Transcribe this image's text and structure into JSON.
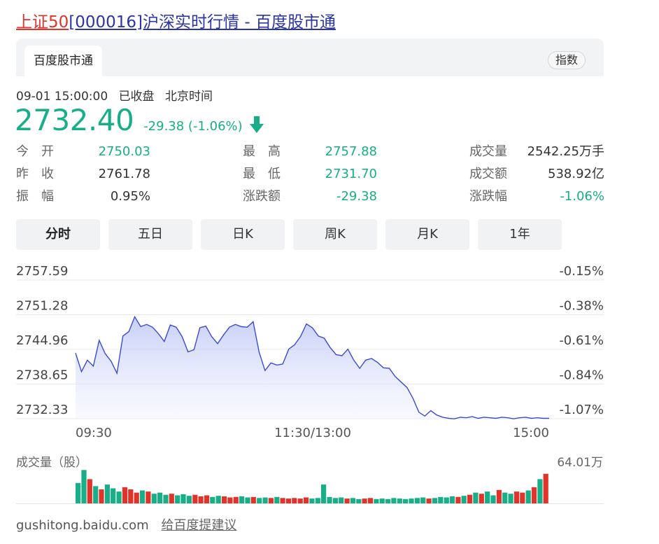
{
  "title": {
    "index_name": "上证50",
    "rest": "[000016]沪深实时行情 - 百度股市通"
  },
  "tabbar": {
    "active_tab": "百度股市通",
    "badge": "指数"
  },
  "status": {
    "datetime": "09-01 15:00:00",
    "state": "已收盘",
    "timezone": "北京时间"
  },
  "quote": {
    "price": "2732.40",
    "change": "-29.38 (-1.06%)"
  },
  "stats": [
    [
      {
        "label": "今　开",
        "value": "2750.03",
        "color": "green"
      },
      {
        "label": "最　高",
        "value": "2757.88",
        "color": "green"
      },
      {
        "label": "成交量",
        "value": "2542.25万手",
        "color": "dark"
      }
    ],
    [
      {
        "label": "昨　收",
        "value": "2761.78",
        "color": "dark"
      },
      {
        "label": "最　低",
        "value": "2731.70",
        "color": "green"
      },
      {
        "label": "成交额",
        "value": "538.92亿",
        "color": "dark"
      }
    ],
    [
      {
        "label": "振　幅",
        "value": "0.95%",
        "color": "dark"
      },
      {
        "label": "涨跌额",
        "value": "-29.38",
        "color": "green"
      },
      {
        "label": "涨跌幅",
        "value": "-1.06%",
        "color": "green"
      }
    ]
  ],
  "periods": [
    "分时",
    "五日",
    "日K",
    "周K",
    "月K",
    "1年"
  ],
  "chart_data": {
    "type": "line",
    "y_left_ticks": [
      "2757.59",
      "2751.28",
      "2744.96",
      "2738.65",
      "2732.33"
    ],
    "y_right_ticks": [
      "-0.15%",
      "-0.38%",
      "-0.61%",
      "-0.84%",
      "-1.07%"
    ],
    "x_ticks": [
      "09:30",
      "11:30/13:00",
      "15:00"
    ],
    "ylim": [
      2732.33,
      2757.59
    ],
    "x": [
      0,
      3,
      6,
      9,
      12,
      15,
      18,
      21,
      24,
      27,
      30,
      33,
      36,
      39,
      42,
      45,
      48,
      51,
      54,
      57,
      60,
      63,
      66,
      69,
      72,
      75,
      78,
      81,
      84,
      87,
      90,
      93,
      96,
      99,
      102,
      105,
      108,
      111,
      114,
      117,
      120,
      123,
      126,
      129,
      132,
      135,
      138,
      141,
      144,
      147,
      150,
      153,
      156,
      159,
      162,
      165,
      168,
      171,
      174,
      177,
      180,
      183,
      186,
      189,
      192,
      195,
      198,
      201,
      204,
      207,
      210,
      213,
      216,
      219,
      222,
      225,
      228,
      231,
      234,
      237,
      240
    ],
    "values": [
      2744.3,
      2740.9,
      2743.0,
      2741.9,
      2746.6,
      2744.2,
      2742.8,
      2740.6,
      2747.4,
      2748.2,
      2750.9,
      2749.1,
      2749.5,
      2749.0,
      2747.8,
      2746.4,
      2749.4,
      2749.0,
      2747.3,
      2744.5,
      2744.9,
      2748.9,
      2749.2,
      2747.3,
      2746.0,
      2747.6,
      2749.0,
      2749.5,
      2749.1,
      2749.0,
      2750.0,
      2744.5,
      2741.1,
      2742.5,
      2742.1,
      2742.3,
      2745.0,
      2745.8,
      2747.3,
      2749.6,
      2748.9,
      2747.4,
      2747.0,
      2745.3,
      2744.0,
      2743.8,
      2745.0,
      2743.0,
      2741.5,
      2743.0,
      2743.3,
      2742.6,
      2741.6,
      2741.5,
      2740.0,
      2739.0,
      2738.0,
      2736.0,
      2733.5,
      2732.8,
      2733.8,
      2733.0,
      2732.6,
      2732.4,
      2732.3,
      2732.6,
      2732.5,
      2732.7,
      2732.4,
      2732.6,
      2732.5,
      2732.4,
      2732.6,
      2732.5,
      2732.3,
      2732.5,
      2732.6,
      2732.4,
      2732.5,
      2732.4,
      2732.4
    ]
  },
  "volume": {
    "label": "成交量（股）",
    "max_label": "64.01万",
    "values": [
      0.38,
      0.62,
      0.45,
      0.32,
      0.26,
      0.35,
      0.28,
      0.22,
      0.3,
      0.26,
      0.2,
      0.24,
      0.22,
      0.18,
      0.2,
      0.16,
      0.18,
      0.15,
      0.17,
      0.14,
      0.16,
      0.13,
      0.15,
      0.12,
      0.14,
      0.13,
      0.11,
      0.12,
      0.13,
      0.11,
      0.12,
      0.1,
      0.11,
      0.1,
      0.12,
      0.1,
      0.09,
      0.1,
      0.09,
      0.11,
      0.09,
      0.1,
      0.35,
      0.12,
      0.1,
      0.11,
      0.09,
      0.1,
      0.08,
      0.09,
      0.1,
      0.08,
      0.09,
      0.08,
      0.1,
      0.09,
      0.08,
      0.09,
      0.1,
      0.11,
      0.09,
      0.1,
      0.12,
      0.11,
      0.13,
      0.12,
      0.14,
      0.16,
      0.2,
      0.18,
      0.22,
      0.15,
      0.25,
      0.2,
      0.18,
      0.22,
      0.2,
      0.24,
      0.3,
      0.45,
      0.55
    ],
    "colors": {
      "up": "#e0332a",
      "down": "#18ae87"
    }
  },
  "footer": {
    "source": "gushitong.baidu.com",
    "feedback": "给百度提建议"
  }
}
